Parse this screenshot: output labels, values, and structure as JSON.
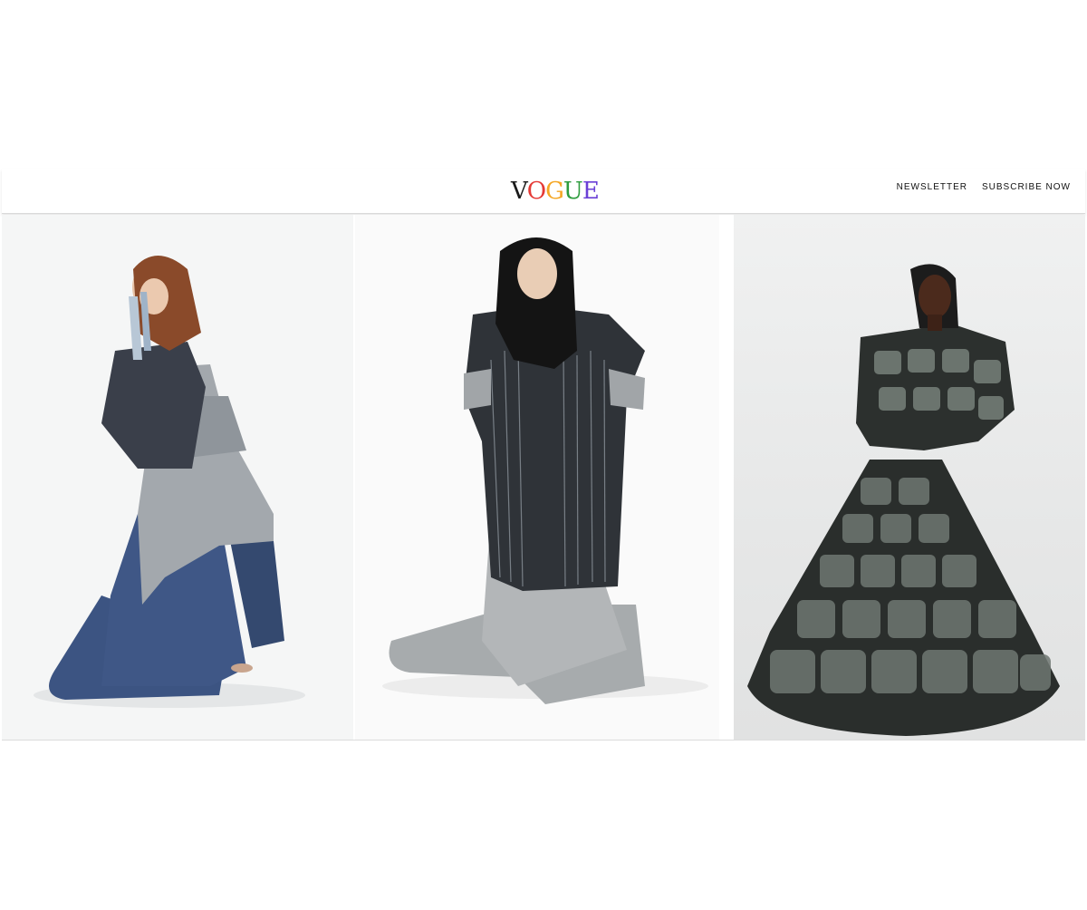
{
  "header": {
    "logo": {
      "letters": [
        {
          "char": "V",
          "color": "#1a1a1a"
        },
        {
          "char": "O",
          "color": "#e53935"
        },
        {
          "char": "G",
          "color": "#f5a623"
        },
        {
          "char": "U",
          "color": "#2e9c3e"
        },
        {
          "char": "E",
          "color": "#6a3fd6"
        }
      ]
    },
    "nav": {
      "newsletter": "NEWSLETTER",
      "subscribe": "SUBSCRIBE NOW"
    }
  },
  "gallery": {
    "photos": [
      {
        "subject": "model in layered denim and grey patchwork coat with long train"
      },
      {
        "subject": "model in black frayed-strip sleeveless coat over grey trousers with train"
      },
      {
        "subject": "model in padded gown made of printed pillow-like panels"
      }
    ]
  },
  "colors": {
    "denim_blue": "#3d5480",
    "grey_fabric": "#9ea3a8",
    "dark_panels": "#2b2f2d"
  }
}
